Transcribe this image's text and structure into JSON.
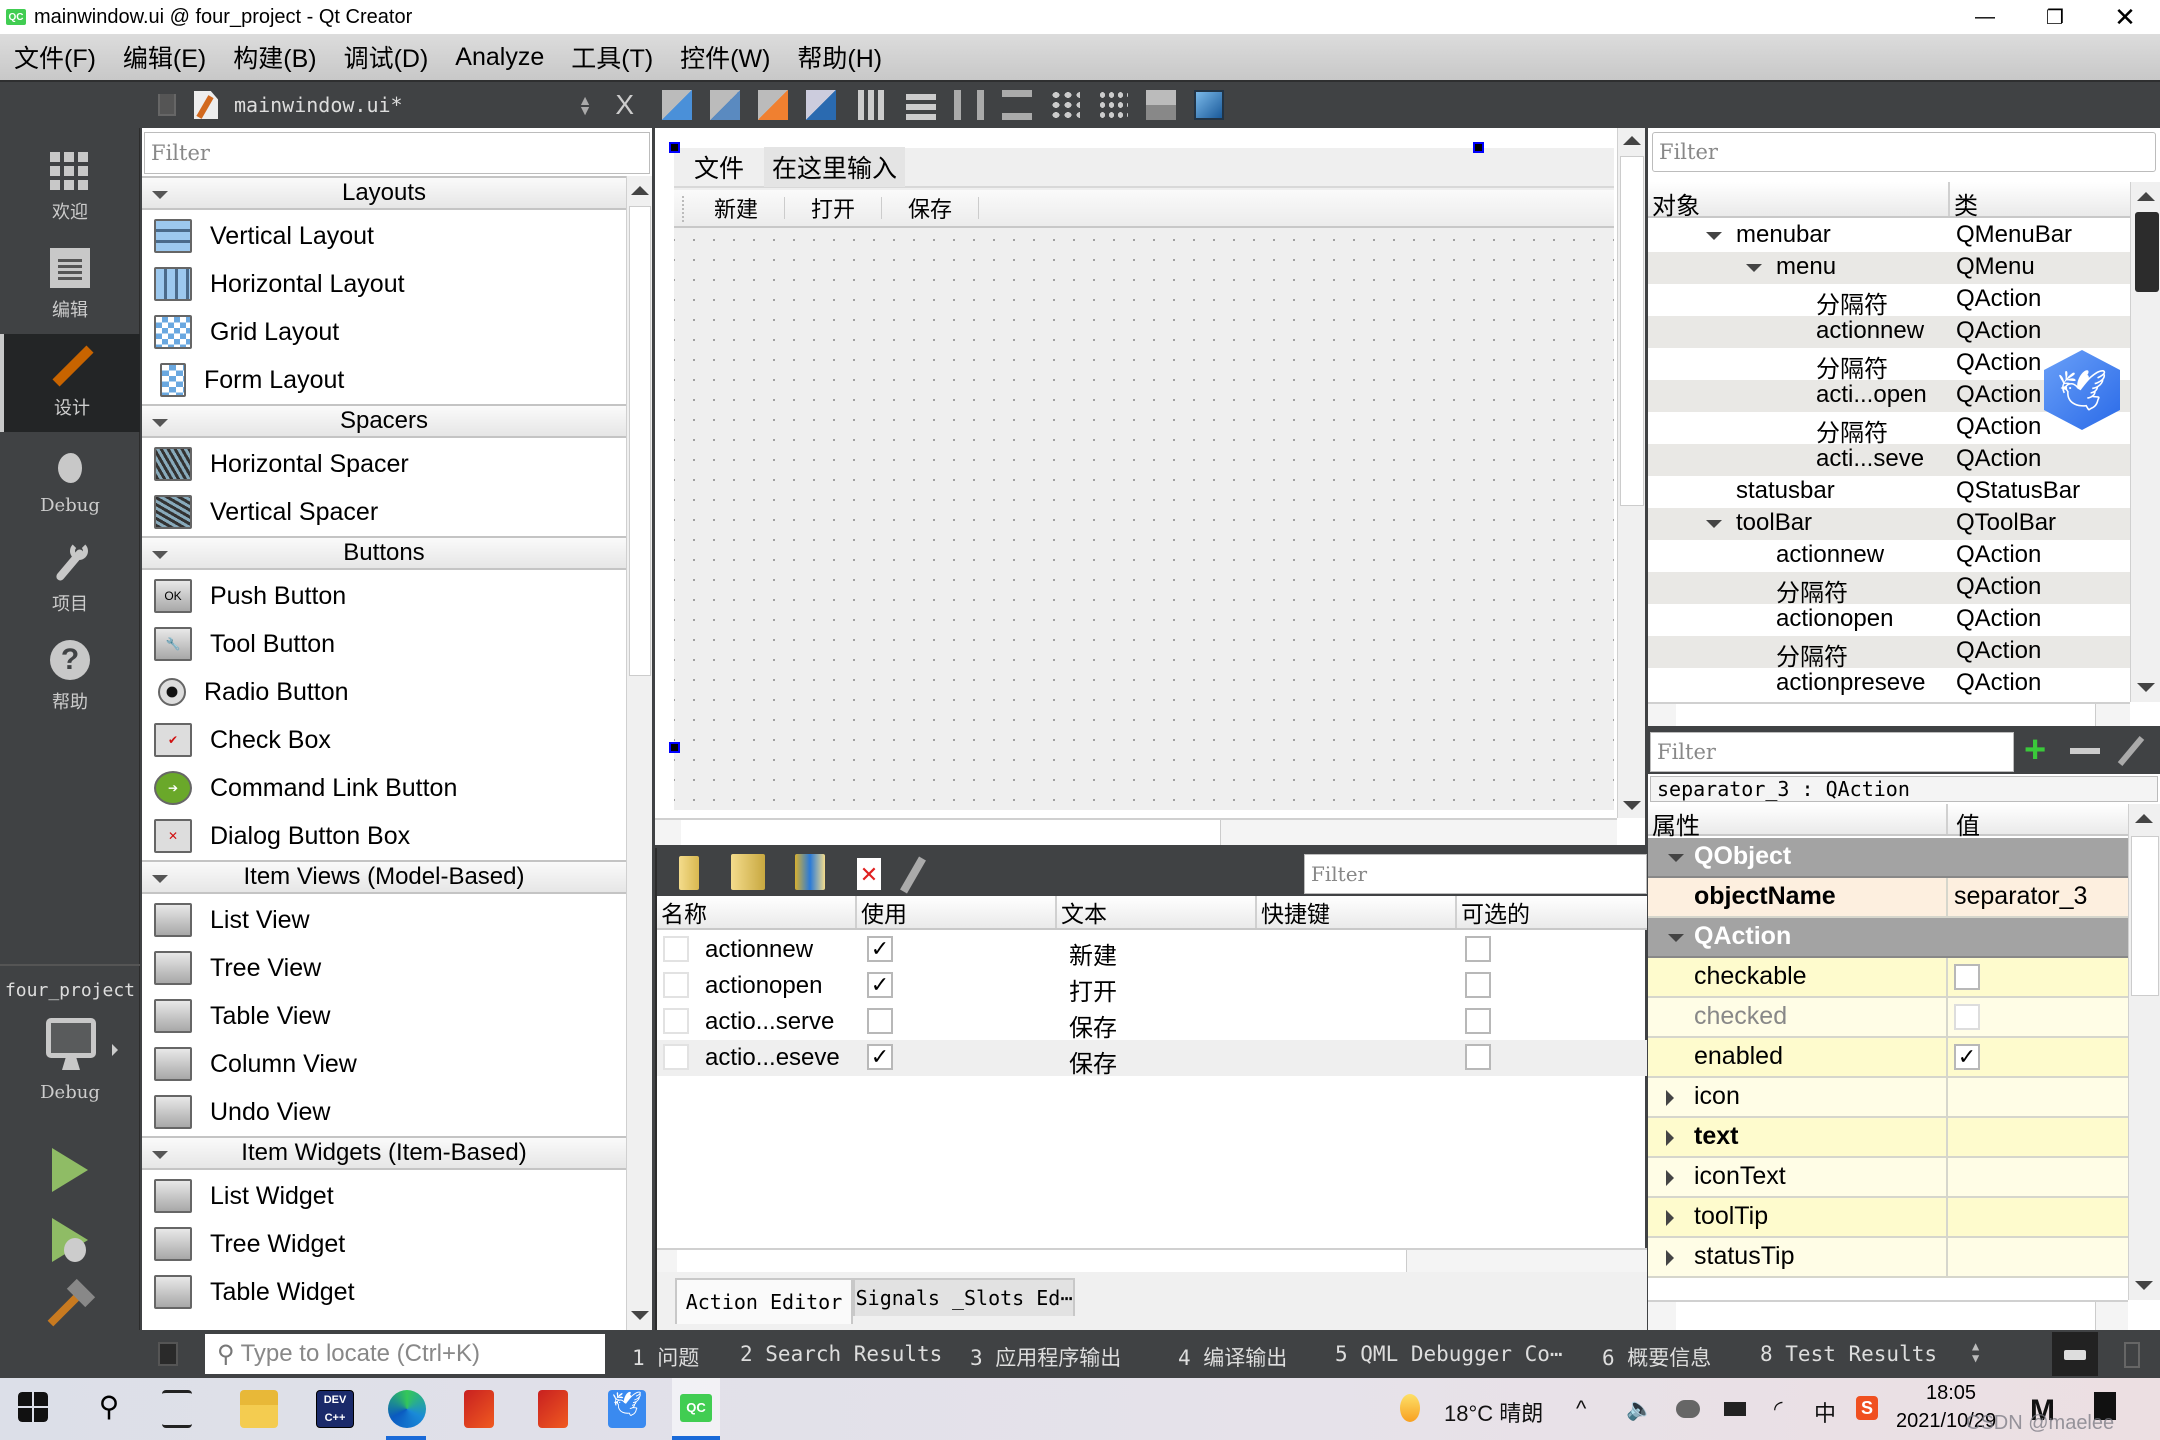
{
  "window": {
    "app_icon": "qt-creator-icon",
    "title": "mainwindow.ui @ four_project - Qt Creator",
    "controls": [
      "minimize",
      "restore",
      "close"
    ]
  },
  "menubar": {
    "items": [
      "文件(F)",
      "编辑(E)",
      "构建(B)",
      "调试(D)",
      "Analyze",
      "工具(T)",
      "控件(W)",
      "帮助(H)"
    ]
  },
  "editor_toolbar": {
    "document": "mainwindow.ui*",
    "close_label": "X",
    "tools": [
      "edit-widgets",
      "edit-signals-slots",
      "edit-buddies",
      "edit-tab-order",
      "layout-horizontal",
      "layout-vertical",
      "layout-horizontal-splitter",
      "layout-vertical-splitter",
      "layout-grid",
      "layout-form",
      "break-layout",
      "adjust-size"
    ]
  },
  "modebar": {
    "modes": [
      {
        "label": "欢迎",
        "icon": "grid-icon"
      },
      {
        "label": "编辑",
        "icon": "document-icon"
      },
      {
        "label": "设计",
        "icon": "pencil-icon",
        "active": true
      },
      {
        "label": "Debug",
        "icon": "bug-icon"
      },
      {
        "label": "项目",
        "icon": "wrench-icon"
      },
      {
        "label": "帮助",
        "icon": "help-icon"
      }
    ],
    "project": "four_project",
    "kit": "Debug"
  },
  "widget_box": {
    "filter_placeholder": "Filter",
    "categories": [
      {
        "name": "Layouts",
        "items": [
          "Vertical Layout",
          "Horizontal Layout",
          "Grid Layout",
          "Form Layout"
        ]
      },
      {
        "name": "Spacers",
        "items": [
          "Horizontal Spacer",
          "Vertical Spacer"
        ]
      },
      {
        "name": "Buttons",
        "items": [
          "Push Button",
          "Tool Button",
          "Radio Button",
          "Check Box",
          "Command Link Button",
          "Dialog Button Box"
        ]
      },
      {
        "name": "Item Views (Model-Based)",
        "items": [
          "List View",
          "Tree View",
          "Table View",
          "Column View",
          "Undo View"
        ]
      },
      {
        "name": "Item Widgets (Item-Based)",
        "items": [
          "List Widget",
          "Tree Widget",
          "Table Widget"
        ]
      }
    ]
  },
  "form": {
    "menubar": [
      "文件",
      "在这里输入"
    ],
    "toolbar": [
      "新建",
      "打开",
      "保存"
    ]
  },
  "action_editor": {
    "filter_placeholder": "Filter",
    "tools": [
      "new-action",
      "copy-action",
      "paste-action",
      "delete-action",
      "configure"
    ],
    "columns": [
      "名称",
      "使用",
      "文本",
      "快捷键",
      "可选的"
    ],
    "rows": [
      {
        "name": "actionnew",
        "used": true,
        "text": "新建",
        "shortcut": "",
        "checkable": false
      },
      {
        "name": "actionopen",
        "used": true,
        "text": "打开",
        "shortcut": "",
        "checkable": false
      },
      {
        "name": "actio...serve",
        "used": false,
        "text": "保存",
        "shortcut": "",
        "checkable": false
      },
      {
        "name": "actio...eseve",
        "used": true,
        "text": "保存",
        "shortcut": "",
        "checkable": false
      }
    ],
    "tabs": [
      "Action Editor",
      "Signals _Slots Ed⋯"
    ]
  },
  "object_inspector": {
    "filter_placeholder": "Filter",
    "columns": [
      "对象",
      "类"
    ],
    "rows": [
      {
        "name": "menubar",
        "class": "QMenuBar",
        "level": 1,
        "expanded": true
      },
      {
        "name": "menu",
        "class": "QMenu",
        "level": 2,
        "expanded": true
      },
      {
        "name": "分隔符",
        "class": "QAction",
        "level": 3
      },
      {
        "name": "actionnew",
        "class": "QAction",
        "level": 3
      },
      {
        "name": "分隔符",
        "class": "QAction",
        "level": 3
      },
      {
        "name": "acti...open",
        "class": "QAction",
        "level": 3
      },
      {
        "name": "分隔符",
        "class": "QAction",
        "level": 3
      },
      {
        "name": "acti...seve",
        "class": "QAction",
        "level": 3
      },
      {
        "name": "statusbar",
        "class": "QStatusBar",
        "level": 1
      },
      {
        "name": "toolBar",
        "class": "QToolBar",
        "level": 1,
        "expanded": true
      },
      {
        "name": "actionnew",
        "class": "QAction",
        "level": 2
      },
      {
        "name": "分隔符",
        "class": "QAction",
        "level": 2
      },
      {
        "name": "actionopen",
        "class": "QAction",
        "level": 2
      },
      {
        "name": "分隔符",
        "class": "QAction",
        "level": 2
      },
      {
        "name": "actionpreseve",
        "class": "QAction",
        "level": 2
      }
    ]
  },
  "property_editor": {
    "filter_placeholder": "Filter",
    "selected": "separator_3 : QAction",
    "columns": [
      "属性",
      "值"
    ],
    "groups": [
      {
        "name": "QObject",
        "props": [
          {
            "name": "objectName",
            "value": "separator_3",
            "bold": true
          }
        ]
      },
      {
        "name": "QAction",
        "props": [
          {
            "name": "checkable",
            "checkbox": false
          },
          {
            "name": "checked",
            "checkbox": false,
            "disabled": true
          },
          {
            "name": "enabled",
            "checkbox": true
          },
          {
            "name": "icon",
            "expandable": true
          },
          {
            "name": "text",
            "expandable": true,
            "bold": true
          },
          {
            "name": "iconText",
            "expandable": true
          },
          {
            "name": "toolTip",
            "expandable": true
          },
          {
            "name": "statusTip",
            "expandable": true
          }
        ]
      }
    ]
  },
  "output_bar": {
    "locator_placeholder": "Type to locate (Ctrl+K)",
    "tabs": [
      "1 问题",
      "2 Search Results",
      "3 应用程序输出",
      "4 编译输出",
      "5 QML Debugger Co⋯",
      "6 概要信息",
      "8 Test Results"
    ]
  },
  "taskbar": {
    "apps": [
      "start",
      "search",
      "task-view",
      "file-explorer",
      "dev-cpp",
      "edge",
      "office",
      "office",
      "feishu",
      "qt-creator"
    ],
    "weather": "18°C 晴朗",
    "ime": "中",
    "time": "18:05",
    "date": "2021/10/29",
    "watermark": "CSDN @maelee"
  }
}
